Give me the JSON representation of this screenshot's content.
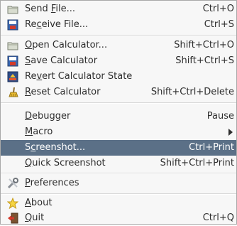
{
  "menu": {
    "items": [
      {
        "id": "send-file",
        "pre": "Send ",
        "mn": "F",
        "post": "ile...",
        "accel": "Ctrl+O",
        "icon": "folder-icon"
      },
      {
        "id": "receive-file",
        "pre": "Re",
        "mn": "c",
        "post": "eive File...",
        "accel": "Ctrl+S",
        "icon": "save-floppy-icon"
      },
      {
        "id": "open-calculator",
        "pre": "",
        "mn": "O",
        "post": "pen Calculator...",
        "accel": "Shift+Ctrl+O",
        "icon": "folder-icon"
      },
      {
        "id": "save-calculator",
        "pre": "",
        "mn": "S",
        "post": "ave Calculator",
        "accel": "Shift+Ctrl+S",
        "icon": "save-floppy-icon"
      },
      {
        "id": "revert-calculator-state",
        "pre": "Re",
        "mn": "v",
        "post": "ert Calculator State",
        "accel": "",
        "icon": "revert-icon"
      },
      {
        "id": "reset-calculator",
        "pre": "",
        "mn": "R",
        "post": "eset Calculator",
        "accel": "Shift+Ctrl+Delete",
        "icon": "clear-broom-icon"
      },
      {
        "id": "debugger",
        "pre": "",
        "mn": "D",
        "post": "ebugger",
        "accel": "Pause",
        "icon": ""
      },
      {
        "id": "macro",
        "pre": "",
        "mn": "M",
        "post": "acro",
        "accel": "",
        "icon": ""
      },
      {
        "id": "screenshot",
        "pre": "S",
        "mn": "c",
        "post": "reenshot...",
        "accel": "Ctrl+Print",
        "icon": ""
      },
      {
        "id": "quick-screenshot",
        "pre": "",
        "mn": "Q",
        "post": "uick Screenshot",
        "accel": "Shift+Ctrl+Print",
        "icon": ""
      },
      {
        "id": "preferences",
        "pre": "",
        "mn": "P",
        "post": "references",
        "accel": "",
        "icon": "preferences-icon"
      },
      {
        "id": "about",
        "pre": "",
        "mn": "A",
        "post": "bout",
        "accel": "",
        "icon": "star-icon"
      },
      {
        "id": "quit",
        "pre": "",
        "mn": "Q",
        "post": "uit",
        "accel": "Ctrl+Q",
        "icon": "quit-icon"
      }
    ],
    "selected_id": "screenshot",
    "submenu_id": "macro"
  },
  "colors": {
    "selection_bg": "#5b7087",
    "menu_bg": "#f7f7f7",
    "text": "#2e2e2e"
  }
}
